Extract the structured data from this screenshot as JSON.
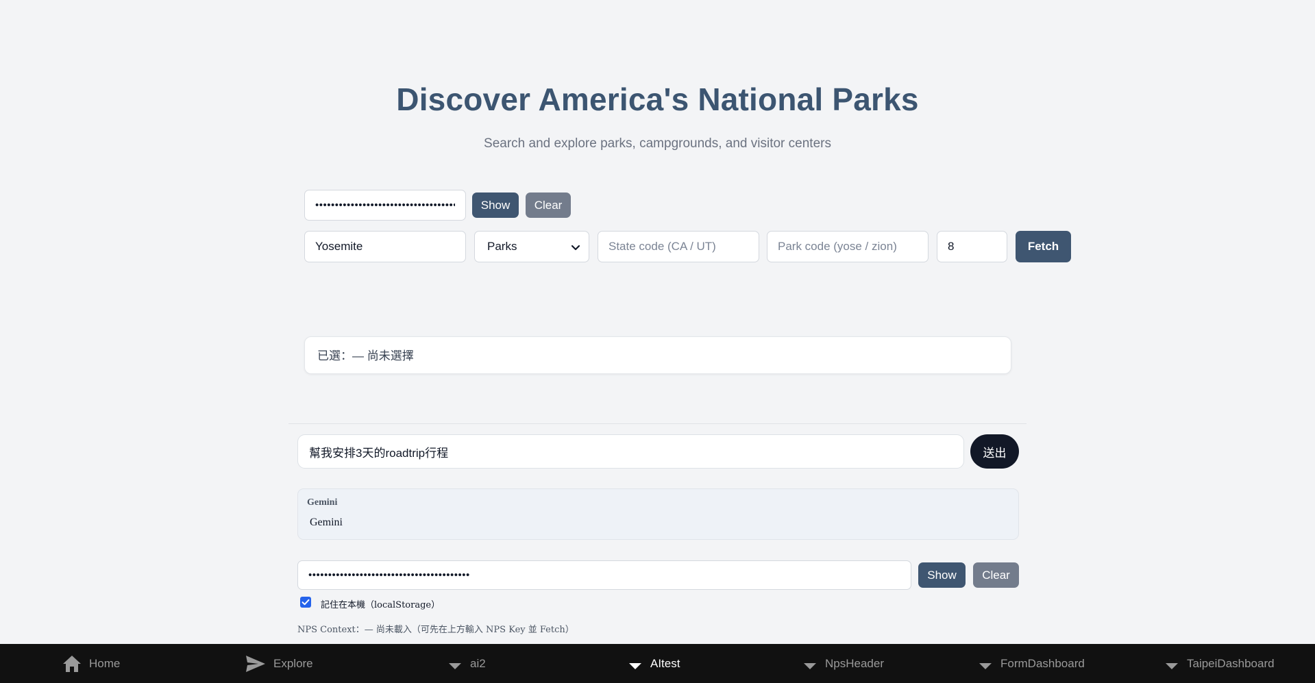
{
  "header": {
    "title": "Discover America's National Parks",
    "subtitle": "Search and explore parks, campgrounds, and visitor centers"
  },
  "nps_key": {
    "masked_value": "••••••••••••••••••••••••••••••••••••••",
    "show_label": "Show",
    "clear_label": "Clear"
  },
  "search": {
    "query_value": "Yosemite",
    "type_selected": "Parks",
    "state_placeholder": "State code (CA / UT)",
    "park_placeholder": "Park code (yose / zion)",
    "limit_value": "8",
    "fetch_label": "Fetch"
  },
  "selection": {
    "label": "已選：— 尚未選擇"
  },
  "chat": {
    "input_value": "幫我安排3天的roadtrip行程",
    "send_label": "送出",
    "response_model": "Gemini",
    "response_text": "Gemini"
  },
  "gemini_key": {
    "masked_value": "•••••••••••••••••••••••••••••••••••••••••",
    "show_label": "Show",
    "clear_label": "Clear",
    "remember_checked": true,
    "remember_label": "記住在本機（localStorage）",
    "context_status": "NPS Context：— 尚未載入（可先在上方輸入 NPS Key 並 Fetch）"
  },
  "nav": {
    "items": [
      {
        "label": "Home",
        "icon": "home-icon",
        "active": false
      },
      {
        "label": "Explore",
        "icon": "send-icon",
        "active": false
      },
      {
        "label": "ai2",
        "icon": "caret-down-icon",
        "active": false
      },
      {
        "label": "AItest",
        "icon": "caret-down-icon",
        "active": true
      },
      {
        "label": "NpsHeader",
        "icon": "caret-down-icon",
        "active": false
      },
      {
        "label": "FormDashboard",
        "icon": "caret-down-icon",
        "active": false
      },
      {
        "label": "TaipeiDashboard",
        "icon": "caret-down-icon",
        "active": false
      }
    ]
  },
  "colors": {
    "title": "#3c5571",
    "primary_button": "#3f5671",
    "secondary_button": "#737c8c",
    "send_button": "#121827",
    "nav_background": "#111111",
    "checkbox": "#2563eb"
  }
}
